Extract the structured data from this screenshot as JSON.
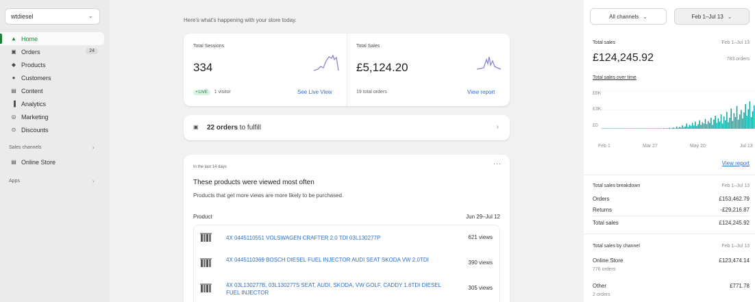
{
  "sidebar": {
    "store": "wtdiesel",
    "items": [
      {
        "label": "Home",
        "icon": "home-icon",
        "glyph": "▲",
        "active": true
      },
      {
        "label": "Orders",
        "icon": "orders-icon",
        "glyph": "▣",
        "badge": "24"
      },
      {
        "label": "Products",
        "icon": "tag-icon",
        "glyph": "◆"
      },
      {
        "label": "Customers",
        "icon": "person-icon",
        "glyph": "●"
      },
      {
        "label": "Content",
        "icon": "content-icon",
        "glyph": "▤"
      },
      {
        "label": "Analytics",
        "icon": "bar-chart-icon",
        "glyph": "▐"
      },
      {
        "label": "Marketing",
        "icon": "target-icon",
        "glyph": "◎"
      },
      {
        "label": "Discounts",
        "icon": "discount-icon",
        "glyph": "⊙"
      }
    ],
    "sales_channels_label": "Sales channels",
    "online_store_label": "Online Store",
    "apps_label": "Apps"
  },
  "main": {
    "greeting": "Here's what's happening with your store today.",
    "sessions": {
      "label": "Total Sessions",
      "value": "334",
      "live_badge": "• LIVE",
      "live_text": "1 visitor",
      "link": "See Live View"
    },
    "sales": {
      "label": "Total Sales",
      "value": "£5,124.20",
      "sub": "19 total orders",
      "link": "View report"
    },
    "orders_count": "22 orders",
    "orders_suffix": " to fulfill",
    "products": {
      "period_label": "In the last 14 days",
      "title": "These products were viewed most often",
      "desc": "Products that get more views are more likely to be purchased.",
      "col_product": "Product",
      "col_range": "Jun 29–Jul 12",
      "rows": [
        {
          "name": "4X 0445110551 VOLSWAGEN CRAFTER 2.0 TDI 03L130277P",
          "views": "621 views"
        },
        {
          "name": "4X 0445110369 BOSCH DIESEL FUEL INJECTOR AUDI SEAT SKODA VW 2.0TDI",
          "views": "390 views"
        },
        {
          "name": "4X 03L130277B, 03L130277S SEAT, AUDI, SKODA, VW GOLF, CADDY 1.6TDI DIESEL FUEL INJECTOR",
          "views": "305 views"
        }
      ]
    }
  },
  "right": {
    "channels_btn": "All channels",
    "date_btn": "Feb 1–Jul 13",
    "total_sales_label": "Total sales",
    "total_sales_range": "Feb 1–Jul 13",
    "total_sales_value": "£124,245.92",
    "total_orders": "783 orders",
    "over_time_label": "Total sales over time",
    "view_report": "View report",
    "breakdown": {
      "label": "Total sales breakdown",
      "range": "Feb 1–Jul 13",
      "rows": [
        {
          "label": "Orders",
          "value": "£153,462.79"
        },
        {
          "label": "Returns",
          "value": "-£29,216.87"
        },
        {
          "label": "Total sales",
          "value": "£124,245.92"
        }
      ]
    },
    "by_channel": {
      "label": "Total sales by channel",
      "range": "Feb 1–Jul 13",
      "rows": [
        {
          "label": "Online Store",
          "sub": "776 orders",
          "value": "£123,474.14"
        },
        {
          "label": "Other",
          "sub": "2 orders",
          "value": "£771.78"
        }
      ]
    }
  },
  "chart_data": {
    "type": "bar",
    "title": "Total sales over time",
    "y_ticks": [
      "£6K",
      "£3K",
      "£0"
    ],
    "x_ticks": [
      "Feb 1",
      "Mar 27",
      "May 20",
      "Jul 13"
    ],
    "ylim": [
      0,
      6000
    ],
    "values": [
      0,
      0,
      0,
      0,
      0,
      20,
      0,
      0,
      0,
      0,
      0,
      0,
      0,
      0,
      0,
      0,
      0,
      0,
      0,
      0,
      0,
      0,
      0,
      0,
      30,
      0,
      0,
      0,
      0,
      0,
      0,
      0,
      40,
      0,
      60,
      0,
      0,
      50,
      0,
      80,
      0,
      70,
      0,
      100,
      0,
      90,
      0,
      150,
      0,
      120,
      200,
      90,
      350,
      150,
      280,
      180,
      500,
      240,
      350,
      800,
      300,
      600,
      450,
      900,
      500,
      1100,
      420,
      700,
      1300,
      600,
      1000,
      800,
      1500,
      700,
      1200,
      900,
      1700,
      600,
      1400,
      2000,
      900,
      1600,
      1100,
      2200,
      800,
      1900,
      1300,
      2600,
      1000,
      1700,
      3100,
      1200,
      2400,
      1800,
      3500,
      1400,
      2200,
      2900,
      1600,
      2500,
      3800,
      2000,
      3000,
      4200,
      1800,
      2700,
      3600
    ],
    "color": "#0fa7a0"
  }
}
